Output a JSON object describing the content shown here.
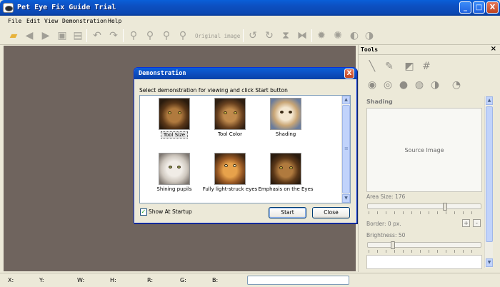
{
  "window": {
    "title": "Pet Eye Fix Guide Trial",
    "controls": {
      "minimize": "_",
      "maximize": "□",
      "close": "X"
    }
  },
  "menu": [
    "File",
    "Edit",
    "View",
    "Demonstration",
    "Help"
  ],
  "toolbar": {
    "original_image_label": "Original image",
    "icons": [
      "open-folder-icon",
      "back-arrow-icon",
      "forward-arrow-icon",
      "save-icon",
      "print-icon",
      "undo-icon",
      "redo-icon",
      "zoom-in-icon",
      "zoom-out-icon",
      "zoom-fit-icon",
      "zoom-actual-icon",
      "rotate-left-icon",
      "rotate-right-icon",
      "flip-vertical-icon",
      "flip-horizontal-icon",
      "settings-icon",
      "gear-small-icon",
      "contrast-icon",
      "contrast-small-icon"
    ]
  },
  "tools_panel": {
    "title": "Tools",
    "close": "×",
    "section": "Shading",
    "source_image": "Source Image",
    "area_size": {
      "label": "Area Size: 176",
      "value_fraction": 0.69
    },
    "border": {
      "label": "Border: 0 px.",
      "plus": "+",
      "minus": "-"
    },
    "brightness": {
      "label": "Brightness: 50",
      "value_fraction": 0.21
    }
  },
  "status": {
    "x": "X:",
    "y": "Y:",
    "w": "W:",
    "h": "H:",
    "r": "R:",
    "g": "G:",
    "b": "B:"
  },
  "dialog": {
    "title": "Demonstration",
    "close": "X",
    "prompt": "Select demonstration for viewing and click Start button",
    "items": [
      {
        "label": "Tool Size"
      },
      {
        "label": "Tool Color"
      },
      {
        "label": "Shading"
      },
      {
        "label": "Shining pupils"
      },
      {
        "label": "Fully light-struck eyes"
      },
      {
        "label": "Emphasis on the Eyes"
      }
    ],
    "show_at_startup": {
      "label": "Show At Startup",
      "checked": true,
      "mark": "✓"
    },
    "start_button": "Start",
    "close_button": "Close"
  }
}
